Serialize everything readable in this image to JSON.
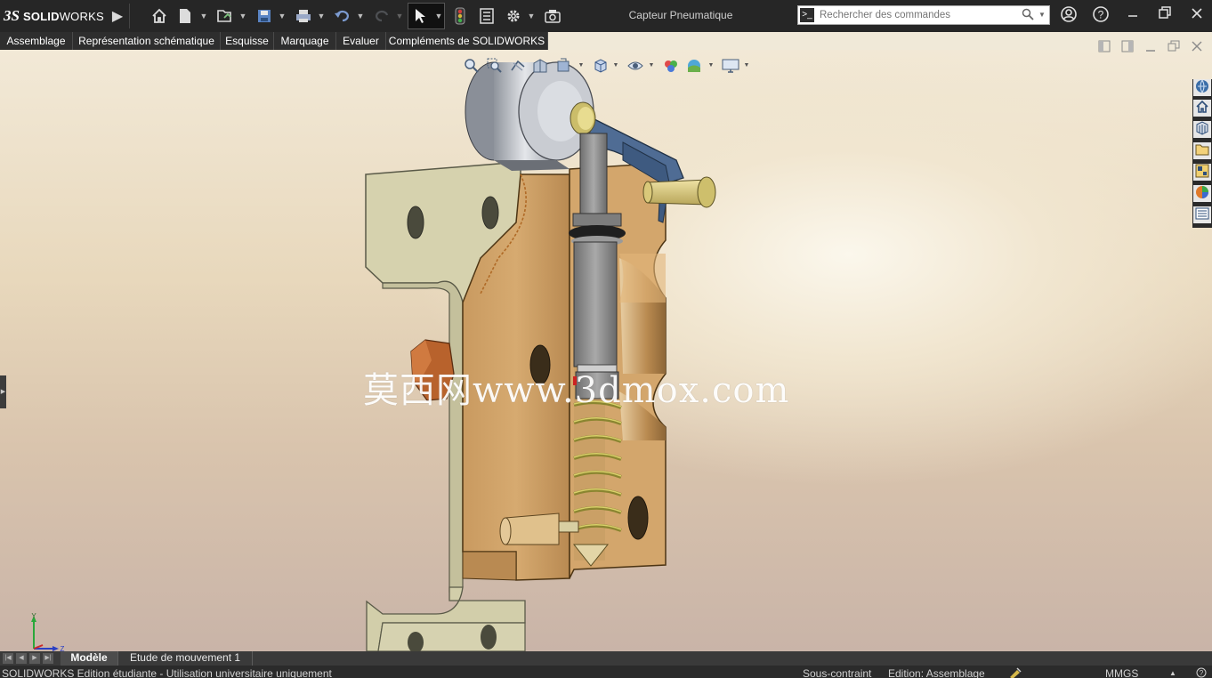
{
  "titlebar": {
    "logo_mark": "3S",
    "logo_bold": "SOLID",
    "logo_light": "WORKS",
    "app_title": "Capteur Pneumatique",
    "icons": [
      "expand-menu-icon",
      "home-icon",
      "new-document-icon",
      "open-document-icon",
      "save-icon",
      "print-icon",
      "undo-icon",
      "redo-icon",
      "select-arrow-icon",
      "rebuild-traffic-light-icon",
      "file-properties-icon",
      "options-gear-icon",
      "screen-capture-icon"
    ],
    "window_icons": [
      "user-account-icon",
      "help-icon",
      "minimize-icon",
      "restore-icon",
      "close-icon"
    ]
  },
  "search": {
    "placeholder": "Rechercher des commandes",
    "value": ""
  },
  "menubar": {
    "items": [
      {
        "label": "Assemblage"
      },
      {
        "label": "Représentation schématique"
      },
      {
        "label": "Esquisse"
      },
      {
        "label": "Marquage"
      },
      {
        "label": "Evaluer"
      },
      {
        "label": "Compléments de SOLIDWORKS"
      }
    ]
  },
  "heads_up_toolbar": {
    "icons": [
      "zoom-to-fit-icon",
      "zoom-to-area-icon",
      "previous-view-icon",
      "section-view-icon",
      "dynamic-annotation-icon",
      "view-orientation-icon",
      "display-style-icon",
      "hide-show-items-icon",
      "edit-appearance-icon",
      "apply-scene-icon",
      "view-settings-icon"
    ]
  },
  "viewport_controls": [
    "tile-left-icon",
    "tile-right-icon",
    "minimize-viewport-icon",
    "restore-viewport-icon",
    "close-viewport-icon"
  ],
  "taskpane": {
    "icons": [
      "solidworks-resources-icon",
      "home-icon",
      "design-library-icon",
      "file-explorer-icon",
      "view-palette-icon",
      "appearances-scenes-icon",
      "custom-properties-icon"
    ]
  },
  "watermark": "莫西网www.3dmox.com",
  "triad": {
    "y_label": "Y",
    "z_label": "Z"
  },
  "tabs": {
    "items": [
      {
        "label": "Modèle",
        "active": true
      },
      {
        "label": "Etude de mouvement 1",
        "active": false
      }
    ]
  },
  "statusbar": {
    "left": "SOLIDWORKS Edition étudiante - Utilisation universitaire uniquement",
    "constraint": "Sous-contraint",
    "edit_mode": "Edition: Assemblage",
    "units": "MMGS",
    "units_arrow": "▲"
  },
  "colors": {
    "chrome_dark": "#262626",
    "menubar_bg": "#2e2e2e",
    "body_block": "#d2a46a",
    "bracket": "#d8d4b2",
    "pin": "#d9c87a",
    "spring": "#8a8530",
    "roller": "#b9bcc4",
    "lever_blue": "#4f6c94",
    "nut": "#b8622c"
  }
}
